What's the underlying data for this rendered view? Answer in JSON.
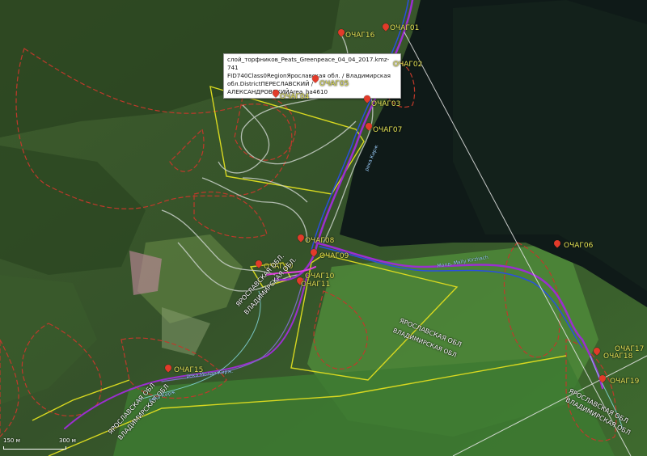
{
  "popup": {
    "line1": "слой_торфников_Peats_Greenpeace_04_04_2017.kmz-741",
    "line2": "FID740Class0RegionЯрославская обл. / Владимирская",
    "line3": "обл.DistrictПЕРЕСЛАВСКИЙ / АЛЕКСАНДРОВСКИЙArea_ha4610"
  },
  "markers": [
    {
      "id": "m01",
      "label": "ОЧАГ01"
    },
    {
      "id": "m02",
      "label": "ОЧАГ02"
    },
    {
      "id": "m03",
      "label": "ОЧАГ03"
    },
    {
      "id": "m04",
      "label": "ОЧАГ04"
    },
    {
      "id": "m05",
      "label": "ОЧАГ05"
    },
    {
      "id": "m06",
      "label": "ОЧАГ06"
    },
    {
      "id": "m07",
      "label": "ОЧАГ07"
    },
    {
      "id": "m08",
      "label": "ОЧАГ08"
    },
    {
      "id": "m09",
      "label": "ОЧАГ09"
    },
    {
      "id": "m10",
      "label": "ОЧАГ10"
    },
    {
      "id": "m11",
      "label": "ОЧАГ11"
    },
    {
      "id": "m15",
      "label": "ОЧАГ15"
    },
    {
      "id": "m16",
      "label": "ОЧАГ16"
    },
    {
      "id": "m17",
      "label": "ОЧАГ17"
    },
    {
      "id": "m18",
      "label": "ОЧАГ18"
    },
    {
      "id": "m19",
      "label": "ОЧАГ19"
    }
  ],
  "regions": {
    "r1": "ЯРОСЛАВСКАЯ ОБЛ.",
    "r2": "ВЛАДИМИРСКАЯ ОБЛ.",
    "r3": "ЯРОСЛАВСКАЯ ОБЛ",
    "r4": "ВЛАДИМИРСКАЯ ОБЛ",
    "r5": "ЯРОСЛАВСКАЯ ОБЛ",
    "r6": "ВЛАДИМИРСКАЯ ОБЛ",
    "r7": "ЯРОСЛАВСКАЯ ОБЛ",
    "r8": "ВЛАДИМИРСКАЯ ОБЛ"
  },
  "rivers": {
    "a": "река Кирж",
    "b": "река Молдр Кирж.",
    "c": "Молд. Mally Kirzhach",
    "d": "река Кирж"
  },
  "scale": {
    "left": "150 м",
    "right": "300 м"
  },
  "colors": {
    "peat_outline": "#c0392b",
    "yellow_boundary": "#d8d820",
    "route_purple": "#9b2fd0",
    "route_blue": "#2a4fe0",
    "track_grey": "#c8d0c8",
    "marker_label": "#e8e85a"
  }
}
